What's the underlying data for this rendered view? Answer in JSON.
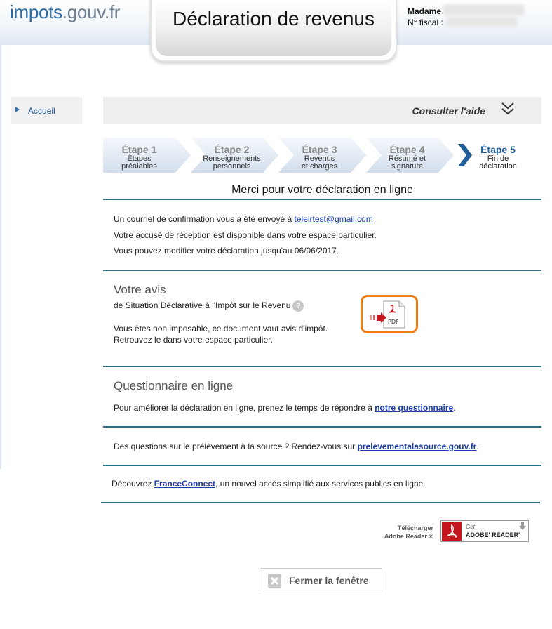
{
  "header": {
    "logo_part1": "impots",
    "logo_part2": ".gouv.fr",
    "title": "Déclaration de revenus",
    "user_title": "Madame",
    "fiscal_label": "N° fiscal :"
  },
  "sidebar": {
    "home": "Accueil"
  },
  "help": {
    "label": "Consulter l'aide"
  },
  "steps": [
    {
      "label": "Étape 1",
      "sub1": "Étapes",
      "sub2": "préalables"
    },
    {
      "label": "Étape 2",
      "sub1": "Renseignements",
      "sub2": "personnels"
    },
    {
      "label": "Étape 3",
      "sub1": "Revenus",
      "sub2": "et charges"
    },
    {
      "label": "Étape 4",
      "sub1": "Résumé et",
      "sub2": "signature"
    },
    {
      "label": "Étape 5",
      "sub1": "Fin de",
      "sub2": "déclaration"
    }
  ],
  "main": {
    "thanks": "Merci pour votre déclaration en ligne",
    "confirm_prefix": "Un courriel de confirmation vous a été envoyé à ",
    "email": "teleirtest@gmail.com",
    "receipt": "Votre accusé de réception est disponible dans votre espace particulier.",
    "modify": "Vous pouvez modifier votre déclaration jusqu'au 06/06/2017."
  },
  "avis": {
    "heading": "Votre avis",
    "subtitle": "de Situation Déclarative à l'Impôt sur le Revenu",
    "help_icon": "?",
    "line1": "Vous êtes non imposable, ce document vaut avis d'impôt.",
    "line2": "Retrouvez le dans votre espace particulier.",
    "pdf_label": "PDF"
  },
  "questionnaire": {
    "heading": "Questionnaire en ligne",
    "text": "Pour améliorer la déclaration en ligne, prenez le temps de répondre à ",
    "link": "notre questionnaire",
    "end": "."
  },
  "prelevement": {
    "text": "Des questions sur le prélèvement à la source ? Rendez-vous sur ",
    "link": "prelevementalasource.gouv.fr",
    "end": "."
  },
  "franceconnect": {
    "prefix": "Découvrez ",
    "link": "FranceConnect",
    "suffix": ", un nouvel accès simplifié aux services publics en ligne."
  },
  "adobe": {
    "line1": "Télécharger",
    "line2": "Adobe Reader ©",
    "btn_get": "Get",
    "btn_name": "ADOBE' READER'"
  },
  "close": {
    "label": "Fermer la fenêtre"
  },
  "colors": {
    "step_active": "#1f5d99",
    "rule": "#2b6f85",
    "pdf_border": "#f07c12",
    "link": "#1f4f86"
  }
}
